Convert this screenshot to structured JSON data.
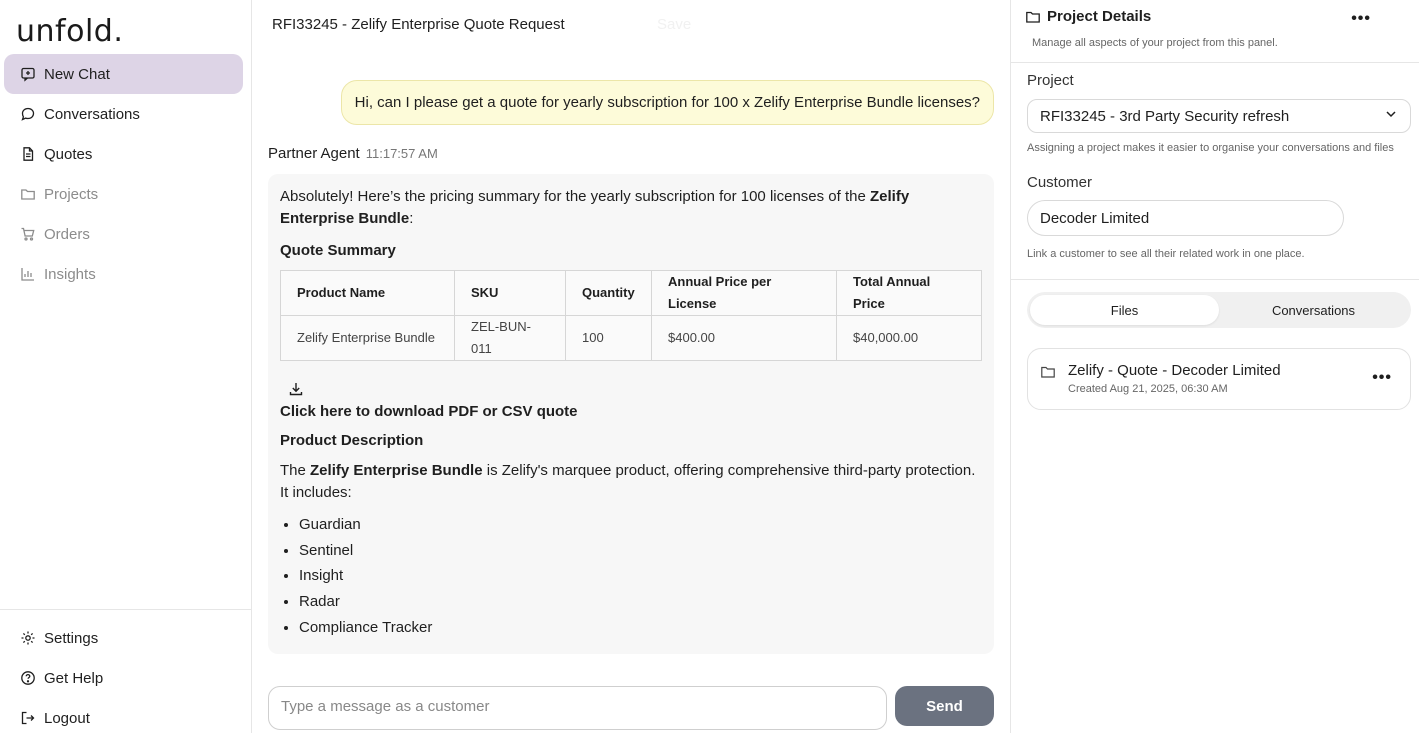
{
  "brand": {
    "logo": "unfold."
  },
  "sidebar": {
    "items": [
      {
        "label": "New Chat",
        "icon": "new-chat-icon",
        "state": "active"
      },
      {
        "label": "Conversations",
        "icon": "chat-bubble-icon",
        "state": "normal"
      },
      {
        "label": "Quotes",
        "icon": "document-icon",
        "state": "normal"
      },
      {
        "label": "Projects",
        "icon": "folder-icon",
        "state": "disabled"
      },
      {
        "label": "Orders",
        "icon": "cart-icon",
        "state": "disabled"
      },
      {
        "label": "Insights",
        "icon": "bar-chart-icon",
        "state": "disabled"
      }
    ],
    "bottom": [
      {
        "label": "Settings",
        "icon": "gear-icon"
      },
      {
        "label": "Get Help",
        "icon": "help-circle-icon"
      },
      {
        "label": "Logout",
        "icon": "logout-icon"
      }
    ]
  },
  "main": {
    "title": "RFI33245 - Zelify Enterprise Quote Request",
    "save_label": "Save",
    "user_message": "Hi, can I please get a quote for yearly subscription for 100 x Zelify Enterprise Bundle licenses?",
    "agent": {
      "name": "Partner Agent",
      "time": "11:17:57 AM",
      "intro_before": "Absolutely! Here’s the pricing summary for the yearly subscription for 100 licenses of the ",
      "intro_bold": "Zelify Enterprise Bundle",
      "intro_after": ":",
      "quote_summary_title": "Quote Summary",
      "table": {
        "headers": [
          "Product Name",
          "SKU",
          "Quantity",
          "Annual Price per License",
          "Total Annual Price"
        ],
        "rows": [
          [
            "Zelify Enterprise Bundle",
            "ZEL-BUN-011",
            "100",
            "$400.00",
            "$40,000.00"
          ]
        ]
      },
      "download_label": "Click here to download PDF or CSV quote",
      "product_description_title": "Product Description",
      "desc_before": "The ",
      "desc_bold": "Zelify Enterprise Bundle",
      "desc_after": " is Zelify's marquee product, offering comprehensive third-party protection. It includes:",
      "features": [
        "Guardian",
        "Sentinel",
        "Insight",
        "Radar",
        "Compliance Tracker"
      ]
    },
    "composer": {
      "placeholder": "Type a message as a customer",
      "send_label": "Send"
    }
  },
  "panel": {
    "title": "Project Details",
    "subtitle": "Manage all aspects of your project from this panel.",
    "project_label": "Project",
    "project_value": "RFI33245 - 3rd Party Security refresh",
    "project_hint": "Assigning a project makes it easier to organise your conversations and files",
    "customer_label": "Customer",
    "customer_value": "Decoder Limited",
    "customer_hint": "Link a customer to see all their related work in one place.",
    "tabs": [
      {
        "label": "Files",
        "active": true
      },
      {
        "label": "Conversations",
        "active": false
      }
    ],
    "files": [
      {
        "name": "Zelify - Quote - Decoder Limited",
        "created": "Created Aug 21, 2025, 06:30 AM"
      }
    ]
  },
  "colors": {
    "active_nav": "#ddd4e6",
    "user_bubble": "#fdfbd9",
    "send_button": "#6b7280"
  }
}
